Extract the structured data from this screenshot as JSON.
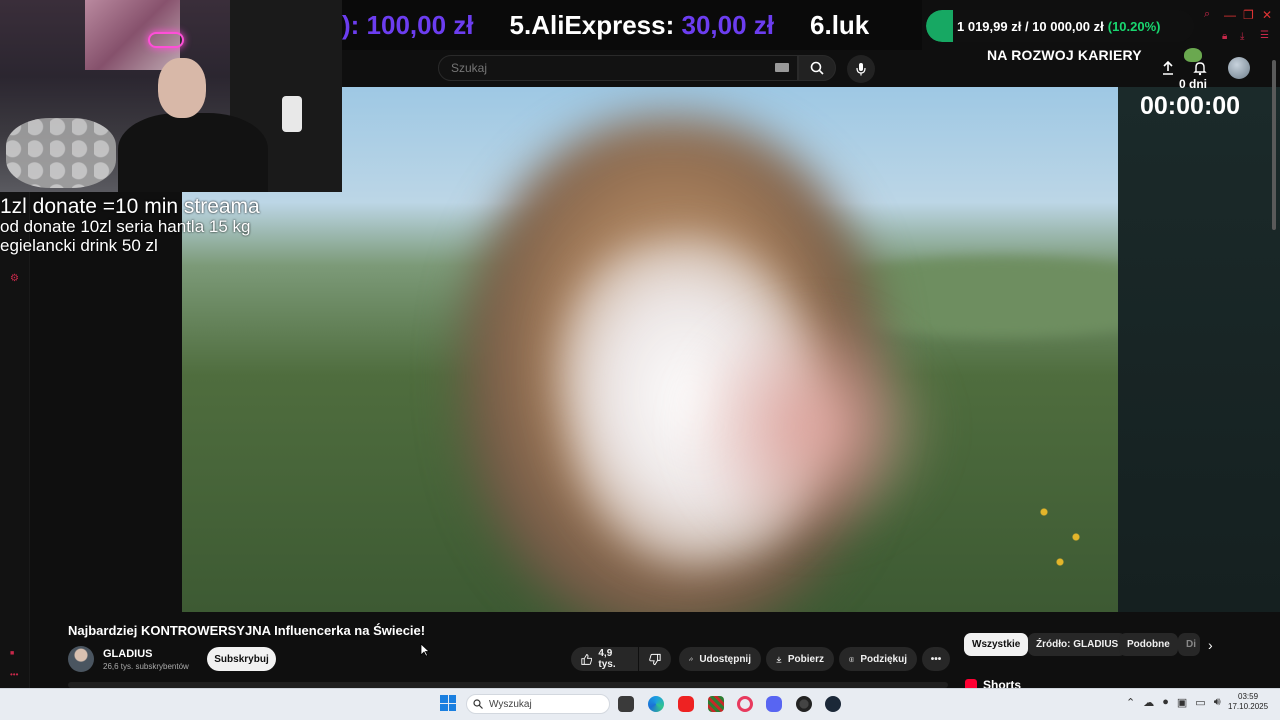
{
  "ticker": {
    "items": [
      {
        "name": "",
        "amount": "): 100,00 zł"
      },
      {
        "name": "5.AliExpress:",
        "amount": "30,00 zł"
      },
      {
        "name": "6.luk",
        "amount": ""
      }
    ]
  },
  "goal": {
    "text": "1 019,99 zł / 10 000,00 zł",
    "percent": "(10.20%)",
    "progress_fraction": 0.102,
    "fill_color": "#17a863"
  },
  "search": {
    "placeholder": "Szukaj"
  },
  "career": {
    "title": "NA ROZWOJ KARIERY",
    "days": "0 dni",
    "timer": "00:00:00"
  },
  "overlay": {
    "line1": "1zl donate =10 min streama",
    "line2": "od donate 10zl seria hantla 15 kg",
    "line3": "egielancki drink 50 zl"
  },
  "video": {
    "title": "Najbardziej KONTROWERSYJNA Influencerka na Świecie!",
    "channel": "GLADIUS",
    "subscribers": "26,6 tys. subskrybentów",
    "subscribe_label": "Subskrybuj",
    "likes": "4,9 tys.",
    "share_label": "Udostępnij",
    "download_label": "Pobierz",
    "thanks_label": "Podziękuj"
  },
  "chips": [
    "Wszystkie",
    "Źródło: GLADIUS",
    "Podobne",
    "Di"
  ],
  "shorts_label": "Shorts",
  "taskbar": {
    "search_placeholder": "Wyszukaj",
    "time": "03:59",
    "date": "17.10.2025"
  },
  "colors": {
    "accent_purple": "#6c3df0",
    "goal_green": "#19d66f",
    "youtube_red": "#ff0033"
  }
}
